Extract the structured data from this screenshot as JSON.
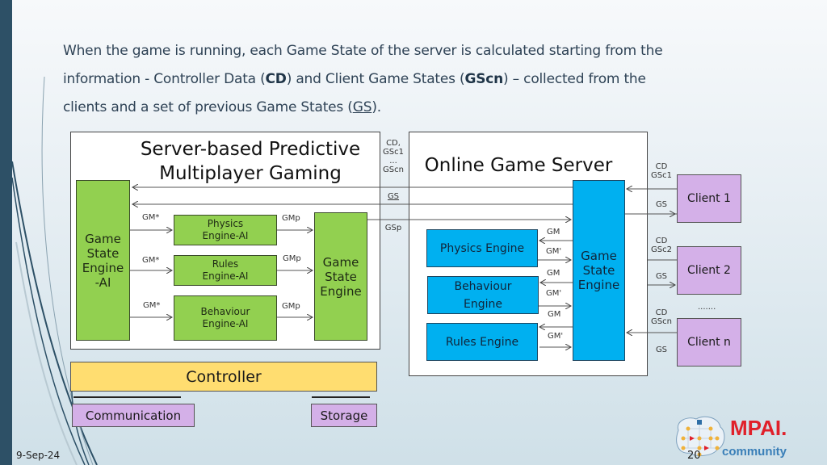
{
  "intro": {
    "line1": "When the game is running, each Game State of the server is calculated starting from the",
    "line2_a": "information  - Controller Data (",
    "line2_cd": "CD",
    "line2_b": ") and Client Game States (",
    "line2_gscn": "GScn",
    "line2_c": ") – collected from the",
    "line3_a": "clients and a set of previous Game States (",
    "line3_gs": "GS",
    "line3_b": ")."
  },
  "predictive_panel": {
    "title_line1": "Server-based Predictive",
    "title_line2": "Multiplayer Gaming",
    "gse_ai": "Game State Engine -AI",
    "gse_ai_lines": [
      "Game",
      "State",
      "Engine",
      "-AI"
    ],
    "physics_ai": [
      "Physics",
      "Engine-AI"
    ],
    "rules_ai": [
      "Rules",
      "Engine-AI"
    ],
    "behaviour_ai": [
      "Behaviour",
      "Engine-AI"
    ],
    "gse_lines": [
      "Game",
      "State",
      "Engine"
    ],
    "gm_star": "GM*",
    "gmp": "GMp"
  },
  "channel_labels": {
    "top": [
      "CD,",
      "GSc1",
      "...",
      "GScn"
    ],
    "gs": "GS",
    "gsp": "GSp"
  },
  "server_panel": {
    "title": "Online Game Server",
    "physics": "Physics Engine",
    "behaviour": [
      "Behaviour",
      "Engine"
    ],
    "rules": "Rules Engine",
    "gse_lines": [
      "Game",
      "State",
      "Engine"
    ],
    "gm": "GM",
    "gm_prime": "GM'"
  },
  "clients": [
    {
      "label": "Client 1",
      "cd": "CD",
      "gsc": "GSc1",
      "gs": "GS"
    },
    {
      "label": "Client 2",
      "cd": "CD",
      "gsc": "GSc2",
      "gs": "GS"
    },
    {
      "label": "Client n",
      "cd": "CD",
      "gsc": "GScn",
      "gs": "GS"
    }
  ],
  "clients_ellipsis": ".......",
  "bottom": {
    "controller": "Controller",
    "communication": "Communication",
    "storage": "Storage"
  },
  "footer": {
    "date": "9-Sep-24",
    "page": "20",
    "logo_main": "MPAI.",
    "logo_sub": "community"
  },
  "colors": {
    "green": "#92d050",
    "blue": "#00b0f0",
    "purple": "#d4b0e8",
    "yellow": "#ffdd70",
    "sidebar": "#2d5066"
  }
}
